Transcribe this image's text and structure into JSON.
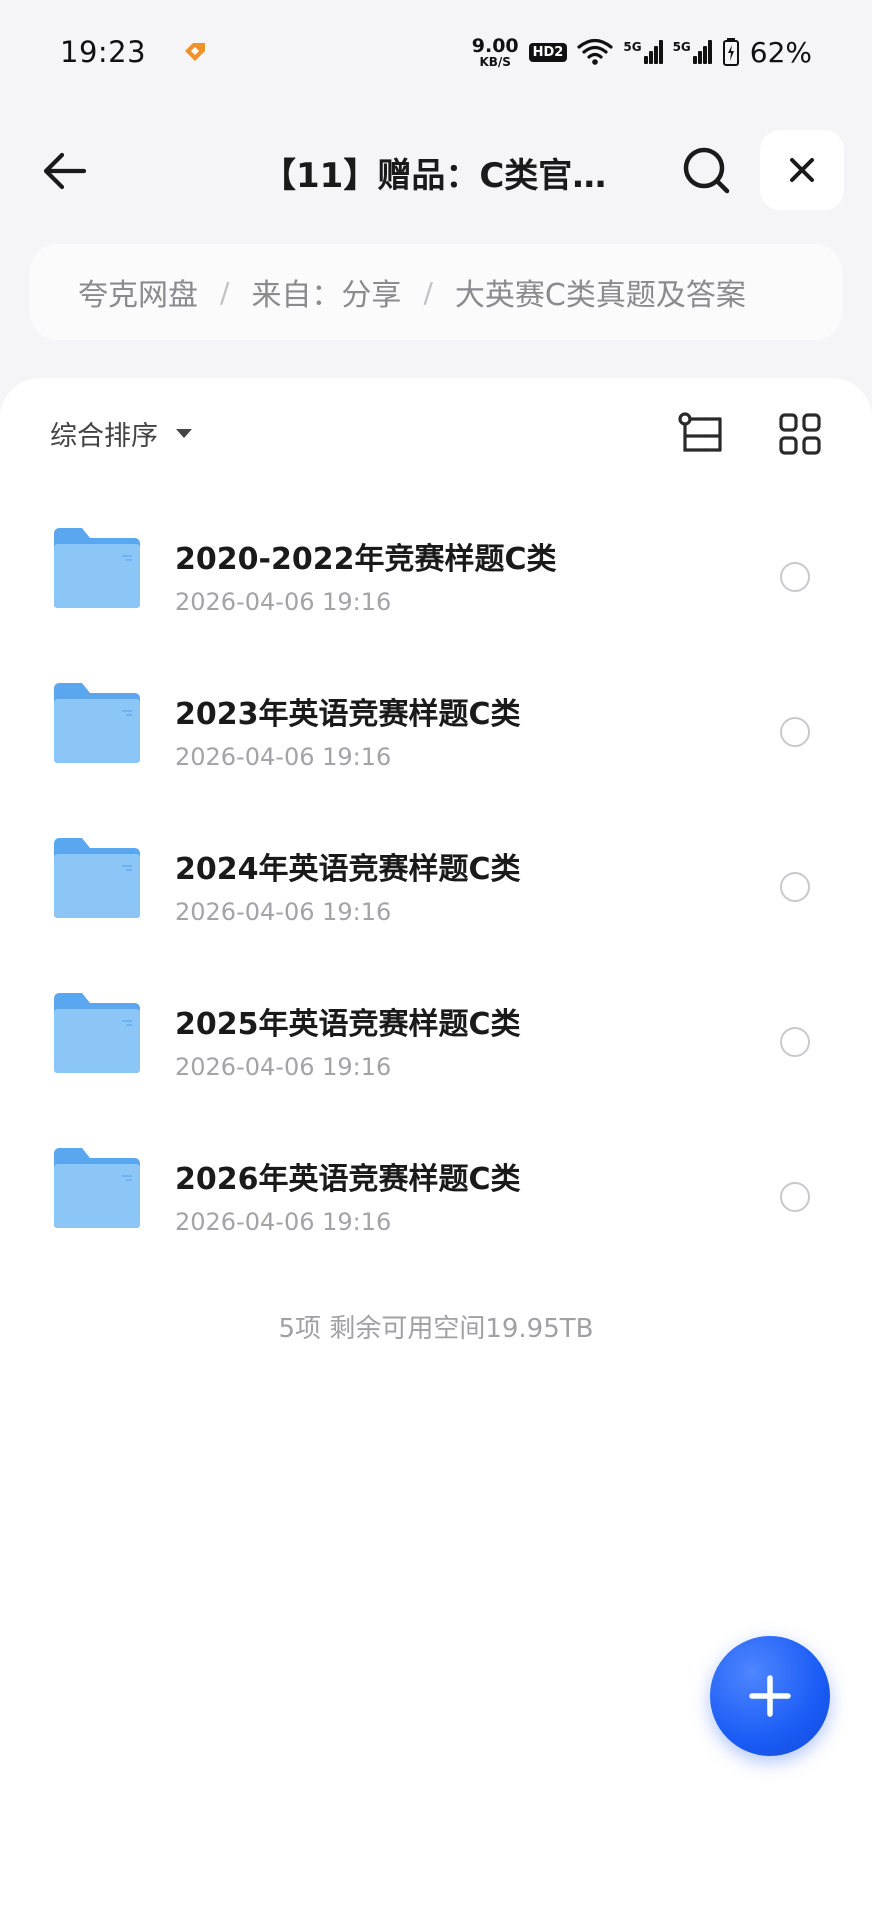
{
  "status_bar": {
    "time": "19:23",
    "net_speed_value": "9.00",
    "net_speed_unit": "KB/S",
    "hd_badge": "HD2",
    "signal_1_label": "5G",
    "signal_2_label": "5G",
    "battery": "62%"
  },
  "header": {
    "title": "【11】赠品：C类官…"
  },
  "breadcrumb": {
    "items": [
      "夸克网盘",
      "来自：分享",
      "大英赛C类真题及答案"
    ],
    "separator": "/"
  },
  "sort": {
    "label": "综合排序"
  },
  "files": [
    {
      "name": "2020-2022年竞赛样题C类",
      "date": "2026-04-06 19:16"
    },
    {
      "name": "2023年英语竞赛样题C类",
      "date": "2026-04-06 19:16"
    },
    {
      "name": "2024年英语竞赛样题C类",
      "date": "2026-04-06 19:16"
    },
    {
      "name": "2025年英语竞赛样题C类",
      "date": "2026-04-06 19:16"
    },
    {
      "name": "2026年英语竞赛样题C类",
      "date": "2026-04-06 19:16"
    }
  ],
  "footer": {
    "summary": "5项 剩余可用空间19.95TB"
  },
  "colors": {
    "accent": "#1a5cf5",
    "folder": "#6fb2f2",
    "app_icon": "#f0922b"
  },
  "icons": {
    "back": "arrow-left-icon",
    "search": "search-icon",
    "close": "close-icon",
    "tree": "tree-view-icon",
    "grid": "grid-view-icon",
    "folder": "folder-icon",
    "add": "plus-icon"
  }
}
